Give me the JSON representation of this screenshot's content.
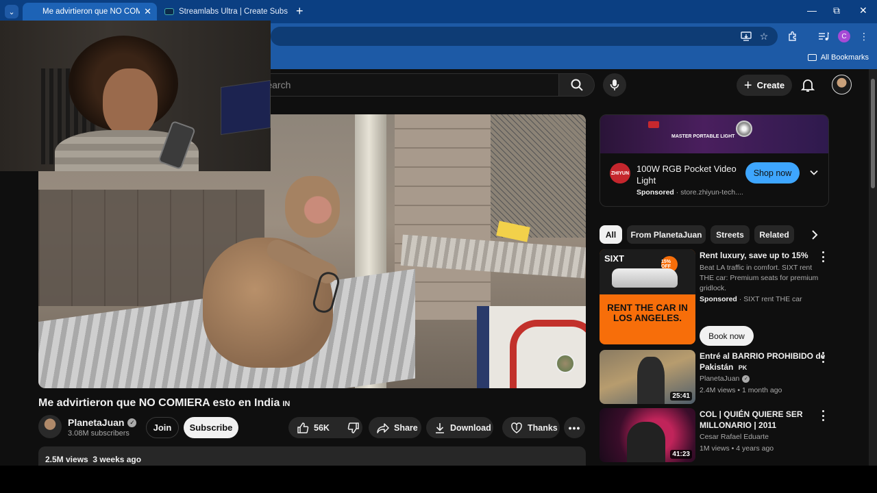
{
  "browser": {
    "tabs": [
      {
        "title": "Me advirtieron que NO COMIER",
        "active": true
      },
      {
        "title": "Streamlabs Ultra | Create Subscr",
        "active": false
      }
    ],
    "bookmarks_label": "All Bookmarks",
    "profile_initial": "C"
  },
  "youtube": {
    "search_placeholder": "Search",
    "create_label": "Create",
    "video": {
      "title": "Me advirtieron que NO COMIERA esto en India",
      "flag": "IN",
      "channel": "PlanetaJuan",
      "subscribers": "3.08M subscribers",
      "join_label": "Join",
      "subscribe_label": "Subscribe",
      "likes": "56K",
      "share_label": "Share",
      "download_label": "Download",
      "thanks_label": "Thanks",
      "views": "2.5M views",
      "age": "3 weeks ago"
    },
    "ad": {
      "banner_text": "MASTER PORTABLE LIGHT",
      "brand_logo": "ZHIYUN",
      "title": "100W RGB Pocket Video Light",
      "sponsored": "Sponsored",
      "domain": "store.zhiyun-tech....",
      "cta": "Shop now"
    },
    "chips": [
      "All",
      "From PlanetaJuan",
      "Streets",
      "Related"
    ],
    "recommendations": [
      {
        "type": "ad",
        "title": "Rent luxury, save up to 15%",
        "description": "Beat LA traffic in comfort. SIXT rent THE car: Premium seats for premium gridlock.",
        "sponsored": "Sponsored",
        "advertiser": "SIXT rent THE car",
        "cta": "Book now",
        "thumb_logo": "SIXT",
        "thumb_badge": "15% OFF",
        "thumb_headline": "RENT THE CAR IN LOS ANGELES."
      },
      {
        "type": "video",
        "title": "Entré al BARRIO PROHIBIDO de Pakistán",
        "flag": "PK",
        "channel": "PlanetaJuan",
        "meta": "2.4M views • 1 month ago",
        "duration": "25:41"
      },
      {
        "type": "video",
        "title": "COL | QUIÉN QUIERE SER MILLONARIO | 2011",
        "channel": "Cesar Rafael Eduarte",
        "meta": "1M views • 4 years ago",
        "duration": "41:23"
      }
    ]
  },
  "colors": {
    "browser_blue": "#1d5aa6",
    "yt_bg": "#0f0f0f",
    "shop_blue": "#3ea6ff",
    "sixt_orange": "#f76e0a"
  }
}
